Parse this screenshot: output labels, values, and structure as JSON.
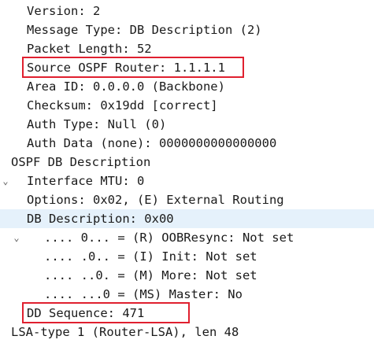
{
  "packet_details": {
    "ospf_header": {
      "version": "Version: 2",
      "message_type": "Message Type: DB Description (2)",
      "packet_length": "Packet Length: 52",
      "source_router": "Source OSPF Router: 1.1.1.1",
      "area_id": "Area ID: 0.0.0.0 (Backbone)",
      "checksum": "Checksum: 0x19dd [correct]",
      "auth_type": "Auth Type: Null (0)",
      "auth_data": "Auth Data (none): 0000000000000000"
    },
    "db_description_section": {
      "label": "OSPF DB Description",
      "expanded": true,
      "interface_mtu": "Interface MTU: 0",
      "options": {
        "label": "Options: 0x02, (E) External Routing",
        "expanded": false
      },
      "db_description": {
        "label": "DB Description: 0x00",
        "expanded": true,
        "selected": true,
        "flags": [
          ".... 0... = (R) OOBResync: Not set",
          ".... .0.. = (I) Init: Not set",
          ".... ..0. = (M) More: Not set",
          ".... ...0 = (MS) Master: No"
        ]
      },
      "dd_sequence": "DD Sequence: 471"
    },
    "lsa_entry": {
      "label": "LSA-type 1 (Router-LSA), len 48",
      "expanded": false
    }
  },
  "icons": {
    "expanded": "chevron-down-icon",
    "collapsed": "chevron-right-icon"
  },
  "colors": {
    "highlight_border": "#e0202f",
    "selected_row": "#e5f1fb",
    "text": "#1a1a1a"
  }
}
